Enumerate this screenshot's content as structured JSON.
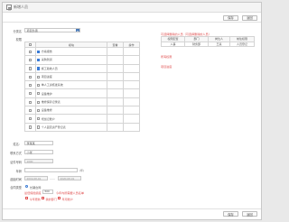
{
  "window": {
    "title": "新增人员"
  },
  "toolbar": {
    "save": "保存",
    "back": "返回"
  },
  "form": {
    "category_label": "分类名",
    "category_value": "项目负责",
    "perm_label": "权限",
    "perm_table": {
      "headers": [
        "",
        "模块",
        "查看",
        "操作"
      ],
      "rows": [
        {
          "checked": true,
          "name": "方案报告"
        },
        {
          "checked": true,
          "name": "采购到货"
        },
        {
          "checked": true,
          "name": "施工验收人员"
        },
        {
          "checked": false,
          "name": "项目进度"
        },
        {
          "checked": false,
          "name": "单人工资核发系统"
        },
        {
          "checked": false,
          "name": "设备维护"
        },
        {
          "checked": false,
          "name": "维修保养记录表"
        },
        {
          "checked": false,
          "name": "设备维修"
        },
        {
          "checked": false,
          "name": "增加记账户"
        },
        {
          "checked": false,
          "name": "个人固定资产登记表"
        }
      ]
    },
    "name_label": "姓名：",
    "name_value": "李某某",
    "contact_label": "联系方式",
    "contact_value": "小张",
    "id_label": "证件号码",
    "id_value": "1000",
    "age_label": "年龄",
    "age_unit": "(年)",
    "date_label": "起始时间",
    "date_start": "2019-08-01",
    "date_sep": "——",
    "date_end": "2020-08-01",
    "type_label": "合同类型",
    "type_option": "长期合同",
    "red_note_prefix": "最低保险额度",
    "red_note_value": "500",
    "red_note_suffix": "今年内所需要人员名单",
    "opts": [
      "今年更新",
      "我的部门",
      "年月账户"
    ]
  },
  "right": {
    "header_note": "可选择删除的人员（可选择删除的人员）",
    "table": {
      "headers": [
        "权限配置",
        "部门",
        "岗位人",
        "前往权限"
      ],
      "rows": [
        [
          "人事",
          "财务部",
          "王某",
          "人员登记"
        ]
      ]
    },
    "red1": "所有权限",
    "red2": "项目进度"
  },
  "footer": {
    "save": "保存",
    "back": "返回"
  },
  "colors": {
    "accent": "#3a7bd5",
    "danger": "#e05050"
  }
}
